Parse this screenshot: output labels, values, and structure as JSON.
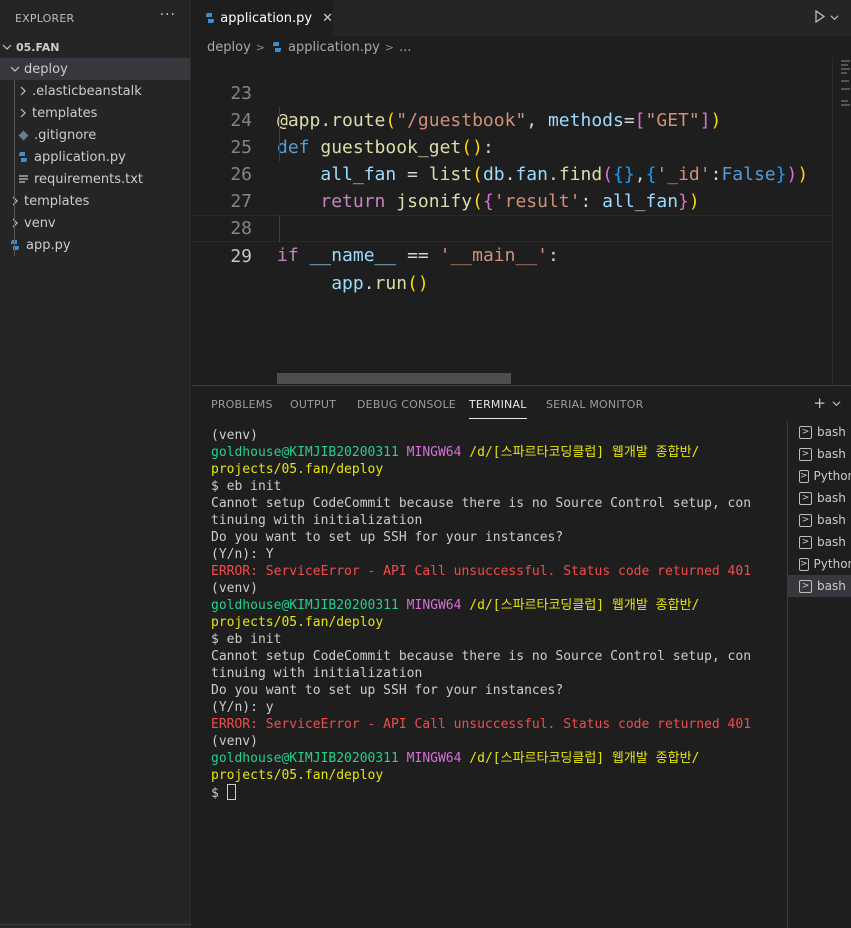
{
  "explorer": {
    "title": "EXPLORER",
    "more": "···",
    "root": "05.FAN",
    "items": [
      {
        "label": "deploy",
        "kind": "folder-open"
      },
      {
        "label": ".elasticbeanstalk",
        "kind": "folder"
      },
      {
        "label": "templates",
        "kind": "folder"
      },
      {
        "label": ".gitignore",
        "kind": "git"
      },
      {
        "label": "application.py",
        "kind": "python"
      },
      {
        "label": "requirements.txt",
        "kind": "text"
      },
      {
        "label": "templates",
        "kind": "folder"
      },
      {
        "label": "venv",
        "kind": "folder"
      },
      {
        "label": "app.py",
        "kind": "python"
      }
    ]
  },
  "editor": {
    "tab_label": "application.py",
    "tab_close": "✕",
    "breadcrumb": [
      "deploy",
      "application.py",
      "..."
    ],
    "line_numbers": [
      "23",
      "24",
      "25",
      "26",
      "27",
      "28",
      "29"
    ]
  },
  "panel": {
    "tabs": [
      "PROBLEMS",
      "OUTPUT",
      "DEBUG CONSOLE",
      "TERMINAL",
      "SERIAL MONITOR"
    ],
    "active_tab": "TERMINAL",
    "add": "+",
    "terminal_lines": [
      [
        {
          "t": "(venv)",
          "c": ""
        }
      ],
      [
        {
          "t": "goldhouse@KIMJIB20200311 ",
          "c": "t-green"
        },
        {
          "t": "MINGW64 ",
          "c": "t-magenta"
        },
        {
          "t": "/d/[스파르타코딩클럽] 웹개발 종합반/",
          "c": "t-yellow"
        }
      ],
      [
        {
          "t": "projects/05.fan/deploy",
          "c": "t-yellow"
        }
      ],
      [
        {
          "t": "$ eb init",
          "c": ""
        }
      ],
      [
        {
          "t": "Cannot setup CodeCommit because there is no Source Control setup, con",
          "c": ""
        }
      ],
      [
        {
          "t": "tinuing with initialization",
          "c": ""
        }
      ],
      [
        {
          "t": "Do you want to set up SSH for your instances?",
          "c": ""
        }
      ],
      [
        {
          "t": "(Y/n): Y",
          "c": ""
        }
      ],
      [
        {
          "t": "ERROR: ServiceError - API Call unsuccessful. Status code returned 401",
          "c": "t-red"
        }
      ],
      [
        {
          "t": "(venv)",
          "c": ""
        }
      ],
      [
        {
          "t": "goldhouse@KIMJIB20200311 ",
          "c": "t-green"
        },
        {
          "t": "MINGW64 ",
          "c": "t-magenta"
        },
        {
          "t": "/d/[스파르타코딩클럽] 웹개발 종합반/",
          "c": "t-yellow"
        }
      ],
      [
        {
          "t": "projects/05.fan/deploy",
          "c": "t-yellow"
        }
      ],
      [
        {
          "t": "$ eb init",
          "c": ""
        }
      ],
      [
        {
          "t": "Cannot setup CodeCommit because there is no Source Control setup, con",
          "c": ""
        }
      ],
      [
        {
          "t": "tinuing with initialization",
          "c": ""
        }
      ],
      [
        {
          "t": "Do you want to set up SSH for your instances?",
          "c": ""
        }
      ],
      [
        {
          "t": "(Y/n): y",
          "c": ""
        }
      ],
      [
        {
          "t": "ERROR: ServiceError - API Call unsuccessful. Status code returned 401",
          "c": "t-red"
        }
      ],
      [
        {
          "t": "(venv)",
          "c": ""
        }
      ],
      [
        {
          "t": "goldhouse@KIMJIB20200311 ",
          "c": "t-green"
        },
        {
          "t": "MINGW64 ",
          "c": "t-magenta"
        },
        {
          "t": "/d/[스파르타코딩클럽] 웹개발 종합반/",
          "c": "t-yellow"
        }
      ],
      [
        {
          "t": "projects/05.fan/deploy",
          "c": "t-yellow"
        }
      ]
    ],
    "prompt": "$ ",
    "terminals": [
      "bash",
      "bash",
      "Python",
      "bash",
      "bash",
      "bash",
      "Python",
      "bash"
    ],
    "selected_terminal": 7
  }
}
